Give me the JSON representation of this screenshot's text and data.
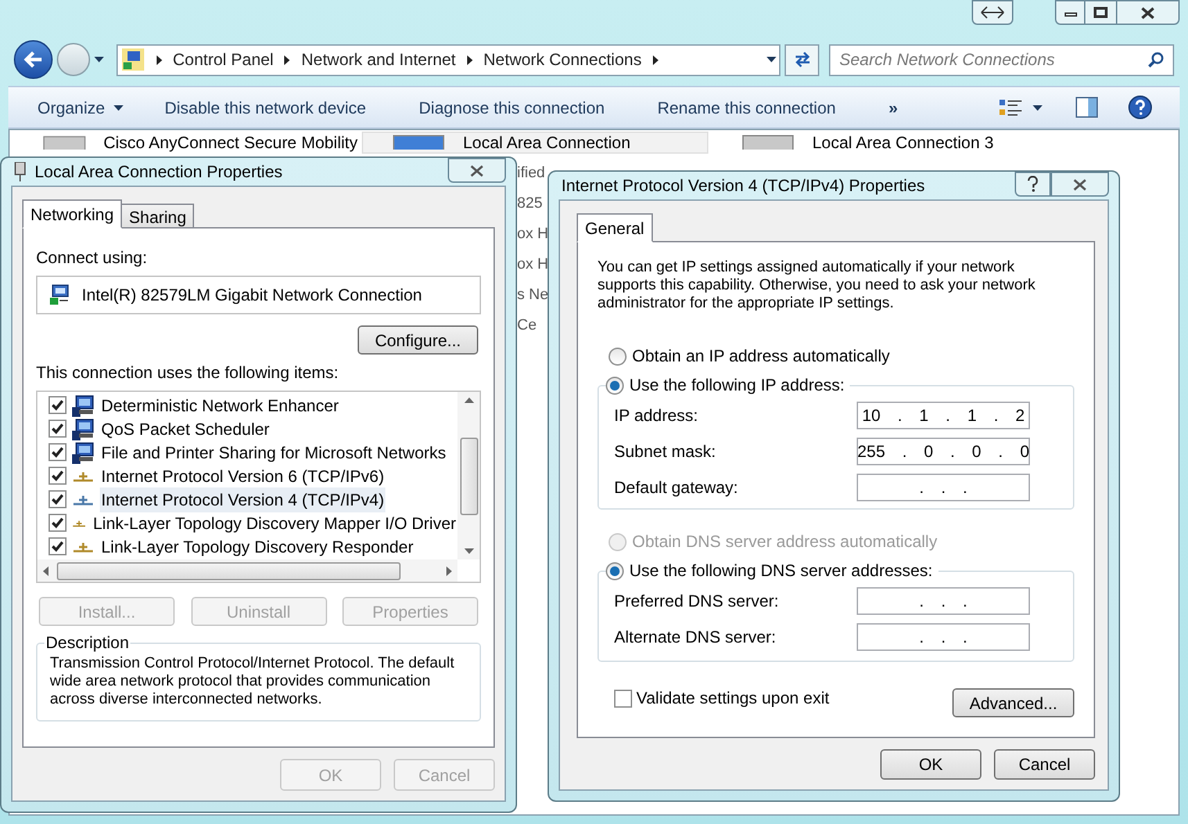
{
  "explorer": {
    "breadcrumbs": [
      "Control Panel",
      "Network and Internet",
      "Network Connections"
    ],
    "search": {
      "placeholder": "Search Network Connections"
    },
    "toolbar": [
      "Organize",
      "Disable this network device",
      "Diagnose this connection",
      "Rename this connection"
    ],
    "overflow": "»",
    "connections": [
      {
        "name": "Cisco AnyConnect Secure Mobility",
        "selected": false
      },
      {
        "name": "Local Area Connection",
        "selected": true
      },
      {
        "name": "Local Area Connection 3",
        "selected": false
      }
    ],
    "fragments": [
      "ified",
      "825",
      "ox H",
      "ox H",
      "s Ne",
      "Ce"
    ]
  },
  "lan_dialog": {
    "title": "Local Area Connection Properties",
    "tabs": [
      {
        "label": "Networking",
        "selected": true
      },
      {
        "label": "Sharing",
        "selected": false
      }
    ],
    "connect_using": "Connect using:",
    "adapter": "Intel(R) 82579LM Gigabit Network Connection",
    "configure": "Configure...",
    "items_label": "This connection uses the following items:",
    "items": [
      {
        "label": "Deterministic Network Enhancer",
        "kind": "service",
        "checked": true,
        "selected": false
      },
      {
        "label": "QoS Packet Scheduler",
        "kind": "service",
        "checked": true,
        "selected": false
      },
      {
        "label": "File and Printer Sharing for Microsoft Networks",
        "kind": "service",
        "checked": true,
        "selected": false
      },
      {
        "label": "Internet Protocol Version 6 (TCP/IPv6)",
        "kind": "protocol",
        "checked": true,
        "selected": false
      },
      {
        "label": "Internet Protocol Version 4 (TCP/IPv4)",
        "kind": "protocol",
        "checked": true,
        "selected": true
      },
      {
        "label": "Link-Layer Topology Discovery Mapper I/O Driver",
        "kind": "protocol",
        "checked": true,
        "selected": false
      },
      {
        "label": "Link-Layer Topology Discovery Responder",
        "kind": "protocol",
        "checked": true,
        "selected": false
      }
    ],
    "item_buttons": [
      {
        "label": "Install...",
        "disabled": true
      },
      {
        "label": "Uninstall",
        "disabled": true
      },
      {
        "label": "Properties",
        "disabled": true
      }
    ],
    "description": {
      "legend": "Description",
      "text": "Transmission Control Protocol/Internet Protocol. The default wide area network protocol that provides communication across diverse interconnected networks."
    },
    "footer": [
      {
        "label": "OK",
        "disabled": true
      },
      {
        "label": "Cancel",
        "disabled": true
      }
    ]
  },
  "ipv4_dialog": {
    "title": "Internet Protocol Version 4 (TCP/IPv4) Properties",
    "tabs": [
      {
        "label": "General",
        "selected": true
      }
    ],
    "intro": "You can get IP settings assigned automatically if your network supports this capability. Otherwise, you need to ask your network administrator for the appropriate IP settings.",
    "ip_auto": {
      "label": "Obtain an IP address automatically",
      "selected": false,
      "disabled": false
    },
    "ip_manual": {
      "label": "Use the following IP address:",
      "selected": true,
      "disabled": false
    },
    "ip_fields": [
      {
        "label": "IP address:",
        "value": "10 . 1 . 1 . 2"
      },
      {
        "label": "Subnet mask:",
        "value": "255 . 0 . 0 . 0"
      },
      {
        "label": "Default gateway:",
        "value": ". . ."
      }
    ],
    "dns_auto": {
      "label": "Obtain DNS server address automatically",
      "selected": false,
      "disabled": true
    },
    "dns_manual": {
      "label": "Use the following DNS server addresses:",
      "selected": true,
      "disabled": false
    },
    "dns_fields": [
      {
        "label": "Preferred DNS server:",
        "value": ". . ."
      },
      {
        "label": "Alternate DNS server:",
        "value": ". . ."
      }
    ],
    "validate": {
      "label": "Validate settings upon exit",
      "checked": false
    },
    "advanced": {
      "label": "Advanced...",
      "disabled": false
    },
    "footer": [
      {
        "label": "OK",
        "disabled": false
      },
      {
        "label": "Cancel",
        "disabled": false
      }
    ]
  }
}
